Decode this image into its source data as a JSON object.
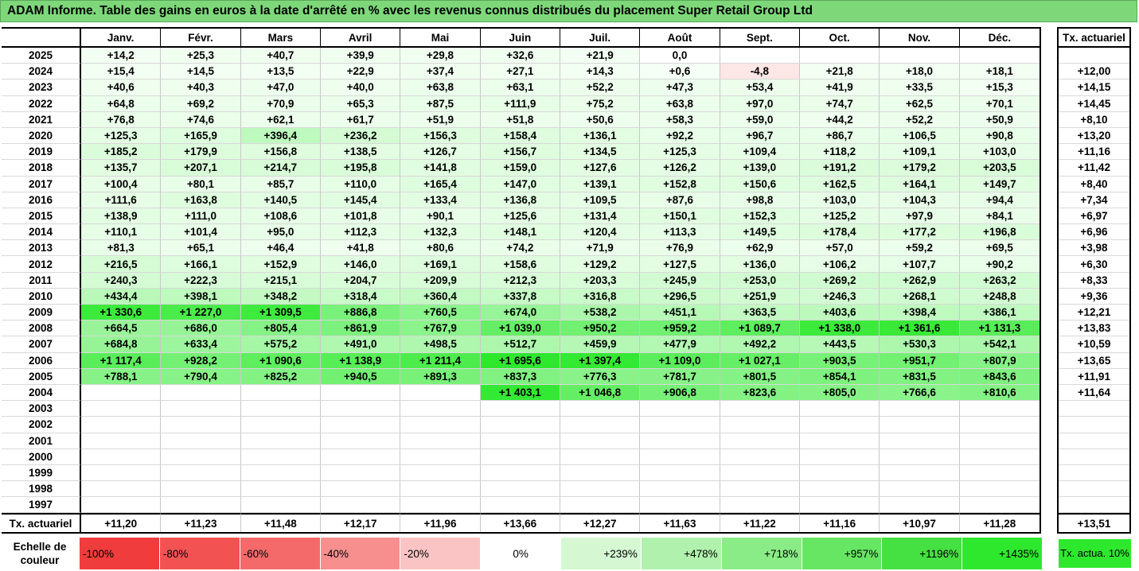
{
  "title": "ADAM Informe. Table des gains en euros à la date d'arrêté en % avec les revenus connus distribués du placement Super Retail Group Ltd",
  "months": [
    "Janv.",
    "Févr.",
    "Mars",
    "Avril",
    "Mai",
    "Juin",
    "Juil.",
    "Août",
    "Sept.",
    "Oct.",
    "Nov.",
    "Déc."
  ],
  "tx_header": "Tx. actuariel",
  "rows": [
    {
      "year": "2025",
      "values": [
        "+14,2",
        "+25,3",
        "+40,7",
        "+39,9",
        "+29,8",
        "+32,6",
        "+21,9",
        "0,0",
        "",
        "",
        "",
        ""
      ],
      "tx": ""
    },
    {
      "year": "2024",
      "values": [
        "+15,4",
        "+14,5",
        "+13,5",
        "+22,9",
        "+37,4",
        "+27,1",
        "+14,3",
        "+0,6",
        "-4,8",
        "+21,8",
        "+18,0",
        "+18,1"
      ],
      "tx": "+12,00"
    },
    {
      "year": "2023",
      "values": [
        "+40,6",
        "+40,3",
        "+47,0",
        "+40,0",
        "+63,8",
        "+63,1",
        "+52,2",
        "+47,3",
        "+53,4",
        "+41,9",
        "+33,5",
        "+15,3"
      ],
      "tx": "+14,15"
    },
    {
      "year": "2022",
      "values": [
        "+64,8",
        "+69,2",
        "+70,9",
        "+65,3",
        "+87,5",
        "+111,9",
        "+75,2",
        "+63,8",
        "+97,0",
        "+74,7",
        "+62,5",
        "+70,1"
      ],
      "tx": "+14,45"
    },
    {
      "year": "2021",
      "values": [
        "+76,8",
        "+74,6",
        "+62,1",
        "+61,7",
        "+51,9",
        "+51,8",
        "+50,6",
        "+58,3",
        "+59,0",
        "+44,2",
        "+52,2",
        "+50,9"
      ],
      "tx": "+8,10"
    },
    {
      "year": "2020",
      "values": [
        "+125,3",
        "+165,9",
        "+396,4",
        "+236,2",
        "+156,3",
        "+158,4",
        "+136,1",
        "+92,2",
        "+96,7",
        "+86,7",
        "+106,5",
        "+90,8"
      ],
      "tx": "+13,20"
    },
    {
      "year": "2019",
      "values": [
        "+185,2",
        "+179,9",
        "+156,8",
        "+138,5",
        "+126,7",
        "+156,7",
        "+134,5",
        "+125,3",
        "+109,4",
        "+118,2",
        "+109,1",
        "+103,0"
      ],
      "tx": "+11,16"
    },
    {
      "year": "2018",
      "values": [
        "+135,7",
        "+207,1",
        "+214,7",
        "+195,8",
        "+141,8",
        "+159,0",
        "+127,6",
        "+126,2",
        "+139,0",
        "+191,2",
        "+179,2",
        "+203,5"
      ],
      "tx": "+11,42"
    },
    {
      "year": "2017",
      "values": [
        "+100,4",
        "+80,1",
        "+85,7",
        "+110,0",
        "+165,4",
        "+147,0",
        "+139,1",
        "+152,8",
        "+150,6",
        "+162,5",
        "+164,1",
        "+149,7"
      ],
      "tx": "+8,40"
    },
    {
      "year": "2016",
      "values": [
        "+111,6",
        "+163,8",
        "+140,5",
        "+145,4",
        "+133,4",
        "+136,8",
        "+109,5",
        "+87,6",
        "+98,8",
        "+103,0",
        "+104,3",
        "+94,4"
      ],
      "tx": "+7,34"
    },
    {
      "year": "2015",
      "values": [
        "+138,9",
        "+111,0",
        "+108,6",
        "+101,8",
        "+90,1",
        "+125,6",
        "+131,4",
        "+150,1",
        "+152,3",
        "+125,2",
        "+97,9",
        "+84,1"
      ],
      "tx": "+6,97"
    },
    {
      "year": "2014",
      "values": [
        "+110,1",
        "+101,4",
        "+95,0",
        "+112,3",
        "+132,3",
        "+148,1",
        "+120,4",
        "+113,3",
        "+149,5",
        "+178,4",
        "+177,2",
        "+196,8"
      ],
      "tx": "+6,96"
    },
    {
      "year": "2013",
      "values": [
        "+81,3",
        "+65,1",
        "+46,4",
        "+41,8",
        "+80,6",
        "+74,2",
        "+71,9",
        "+76,9",
        "+62,9",
        "+57,0",
        "+59,2",
        "+69,5"
      ],
      "tx": "+3,98"
    },
    {
      "year": "2012",
      "values": [
        "+216,5",
        "+166,1",
        "+152,9",
        "+146,0",
        "+169,1",
        "+158,6",
        "+129,2",
        "+127,5",
        "+136,0",
        "+106,2",
        "+107,7",
        "+90,2"
      ],
      "tx": "+6,30"
    },
    {
      "year": "2011",
      "values": [
        "+240,3",
        "+222,3",
        "+215,1",
        "+204,7",
        "+209,9",
        "+212,3",
        "+203,3",
        "+245,9",
        "+253,0",
        "+269,2",
        "+262,9",
        "+263,2"
      ],
      "tx": "+8,33"
    },
    {
      "year": "2010",
      "values": [
        "+434,4",
        "+398,1",
        "+348,2",
        "+318,4",
        "+360,4",
        "+337,8",
        "+316,8",
        "+296,5",
        "+251,9",
        "+246,3",
        "+268,1",
        "+248,8"
      ],
      "tx": "+9,36"
    },
    {
      "year": "2009",
      "values": [
        "+1 330,6",
        "+1 227,0",
        "+1 309,5",
        "+886,8",
        "+760,5",
        "+674,0",
        "+538,2",
        "+451,1",
        "+363,5",
        "+403,6",
        "+398,4",
        "+386,1"
      ],
      "tx": "+12,21"
    },
    {
      "year": "2008",
      "values": [
        "+664,5",
        "+686,0",
        "+805,4",
        "+861,9",
        "+767,9",
        "+1 039,0",
        "+950,2",
        "+959,2",
        "+1 089,7",
        "+1 338,0",
        "+1 361,6",
        "+1 131,3"
      ],
      "tx": "+13,83"
    },
    {
      "year": "2007",
      "values": [
        "+684,8",
        "+633,4",
        "+575,2",
        "+491,0",
        "+498,5",
        "+512,7",
        "+459,9",
        "+477,9",
        "+492,2",
        "+443,5",
        "+530,3",
        "+542,1"
      ],
      "tx": "+10,59"
    },
    {
      "year": "2006",
      "values": [
        "+1 117,4",
        "+928,2",
        "+1 090,6",
        "+1 138,9",
        "+1 211,4",
        "+1 695,6",
        "+1 397,4",
        "+1 109,0",
        "+1 027,1",
        "+903,5",
        "+951,7",
        "+807,9"
      ],
      "tx": "+13,65"
    },
    {
      "year": "2005",
      "values": [
        "+788,1",
        "+790,4",
        "+825,2",
        "+940,5",
        "+891,3",
        "+837,3",
        "+776,3",
        "+781,7",
        "+801,5",
        "+854,1",
        "+831,5",
        "+843,6"
      ],
      "tx": "+11,91"
    },
    {
      "year": "2004",
      "values": [
        "",
        "",
        "",
        "",
        "",
        "+1 403,1",
        "+1 046,8",
        "+906,8",
        "+823,6",
        "+805,0",
        "+766,6",
        "+810,6"
      ],
      "tx": "+11,64"
    },
    {
      "year": "2003",
      "values": [
        "",
        "",
        "",
        "",
        "",
        "",
        "",
        "",
        "",
        "",
        "",
        ""
      ],
      "tx": ""
    },
    {
      "year": "2002",
      "values": [
        "",
        "",
        "",
        "",
        "",
        "",
        "",
        "",
        "",
        "",
        "",
        ""
      ],
      "tx": ""
    },
    {
      "year": "2001",
      "values": [
        "",
        "",
        "",
        "",
        "",
        "",
        "",
        "",
        "",
        "",
        "",
        ""
      ],
      "tx": ""
    },
    {
      "year": "2000",
      "values": [
        "",
        "",
        "",
        "",
        "",
        "",
        "",
        "",
        "",
        "",
        "",
        ""
      ],
      "tx": ""
    },
    {
      "year": "1999",
      "values": [
        "",
        "",
        "",
        "",
        "",
        "",
        "",
        "",
        "",
        "",
        "",
        ""
      ],
      "tx": ""
    },
    {
      "year": "1998",
      "values": [
        "",
        "",
        "",
        "",
        "",
        "",
        "",
        "",
        "",
        "",
        "",
        ""
      ],
      "tx": ""
    },
    {
      "year": "1997",
      "values": [
        "",
        "",
        "",
        "",
        "",
        "",
        "",
        "",
        "",
        "",
        "",
        ""
      ],
      "tx": ""
    }
  ],
  "avg_label": "Tx. actuariel",
  "avg_values": [
    "+11,20",
    "+11,23",
    "+11,48",
    "+12,17",
    "+11,96",
    "+13,66",
    "+12,27",
    "+11,63",
    "+11,22",
    "+11,16",
    "+10,97",
    "+11,28"
  ],
  "avg_tx": "+13,51",
  "scale_label": "Echelle de couleur",
  "scale": [
    {
      "label": "-100%",
      "color": "#f03c3c",
      "kind": "neg"
    },
    {
      "label": "-80%",
      "color": "#f25252",
      "kind": "neg"
    },
    {
      "label": "-60%",
      "color": "#f46a6a",
      "kind": "neg"
    },
    {
      "label": "-40%",
      "color": "#f78f8f",
      "kind": "neg"
    },
    {
      "label": "-20%",
      "color": "#fac4c4",
      "kind": "neg"
    },
    {
      "label": "0%",
      "color": "#ffffff",
      "kind": "zero"
    },
    {
      "label": "+239%",
      "color": "#d5f8d3",
      "kind": "pos"
    },
    {
      "label": "+478%",
      "color": "#b0f2ad",
      "kind": "pos"
    },
    {
      "label": "+718%",
      "color": "#8aec86",
      "kind": "pos"
    },
    {
      "label": "+957%",
      "color": "#66e662",
      "kind": "pos"
    },
    {
      "label": "+1196%",
      "color": "#45e041",
      "kind": "pos"
    },
    {
      "label": "+1435%",
      "color": "#2ee82e",
      "kind": "pos"
    }
  ],
  "legend_tx": "Tx. actua. 10%",
  "colors": {
    "title_bg": "#7ed87a",
    "max_green": "#2ee82e",
    "neg_cell": "#fde6e6"
  }
}
